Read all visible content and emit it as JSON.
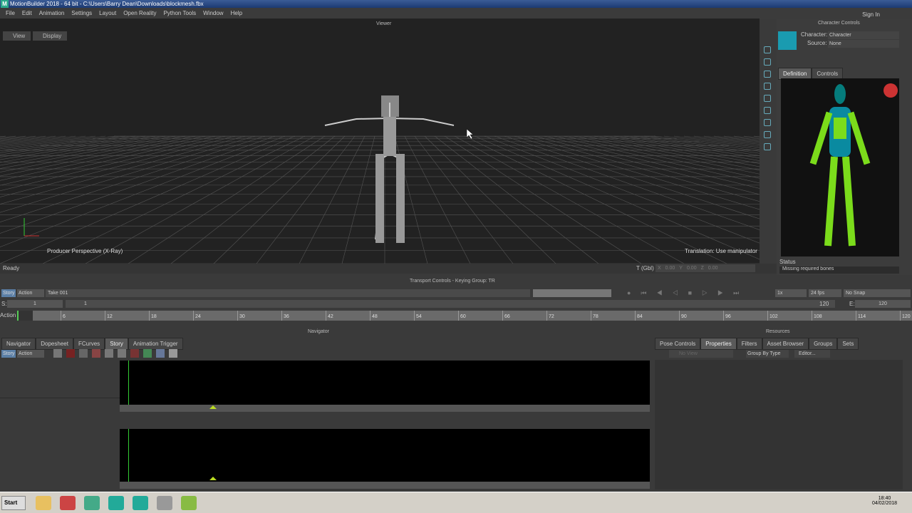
{
  "window": {
    "title": "MotionBuilder 2018 - 64 bit  - C:\\Users\\Barry Dean\\Downloads\\blockmesh.fbx",
    "logo": "M"
  },
  "menu": [
    "File",
    "Edit",
    "Animation",
    "Settings",
    "Layout",
    "Open Reality",
    "Python Tools",
    "Window",
    "Help"
  ],
  "sign_in": "Sign In",
  "viewer": {
    "title": "Viewer",
    "view_btn": "View",
    "display_btn": "Display",
    "camera_label": "Producer Perspective (X-Ray)",
    "hint": "Translation: Use manipulator"
  },
  "status": {
    "text": "Ready",
    "t_label": "T (Gbl)",
    "x": "X",
    "y": "Y",
    "z": "Z",
    "xv": "0.00",
    "yv": "0.00",
    "zv": "0.00"
  },
  "character_controls": {
    "title": "Character Controls",
    "character_label": "Character:",
    "character_value": "Character",
    "source_label": "Source:",
    "source_value": "None",
    "tabs": [
      "Definition",
      "Controls"
    ],
    "status_label": "Status",
    "status_text": "Missing required bones"
  },
  "transport": {
    "header": "Transport Controls  -  Keying Group: TR",
    "story": "Story",
    "action": "Action",
    "take": "Take 001",
    "s_label": "S:",
    "start": "1",
    "current": "1",
    "end_value": "120",
    "e_label": "E:",
    "e_value": "120",
    "speed": "1x",
    "fps": "24 fps",
    "snap": "No Snap",
    "ruler_label": "Action",
    "ticks": [
      "6",
      "12",
      "18",
      "24",
      "30",
      "36",
      "42",
      "48",
      "54",
      "60",
      "66",
      "72",
      "78",
      "84",
      "90",
      "96",
      "102",
      "108",
      "114",
      "120"
    ]
  },
  "navigator": {
    "header": "Navigator",
    "tabs": [
      "Navigator",
      "Dopesheet",
      "FCurves",
      "Story",
      "Animation Trigger"
    ],
    "active_tab": "Story",
    "story": "Story",
    "action": "Action"
  },
  "resources": {
    "header": "Resources",
    "tabs": [
      "Pose Controls",
      "Properties",
      "Filters",
      "Asset Browser",
      "Groups",
      "Sets"
    ],
    "active_tab": "Properties",
    "view": "No View",
    "group_by": "Group By Type",
    "editor": "Editor..."
  },
  "taskbar": {
    "start": "Start",
    "time": "18:40",
    "date": "04/02/2018"
  }
}
